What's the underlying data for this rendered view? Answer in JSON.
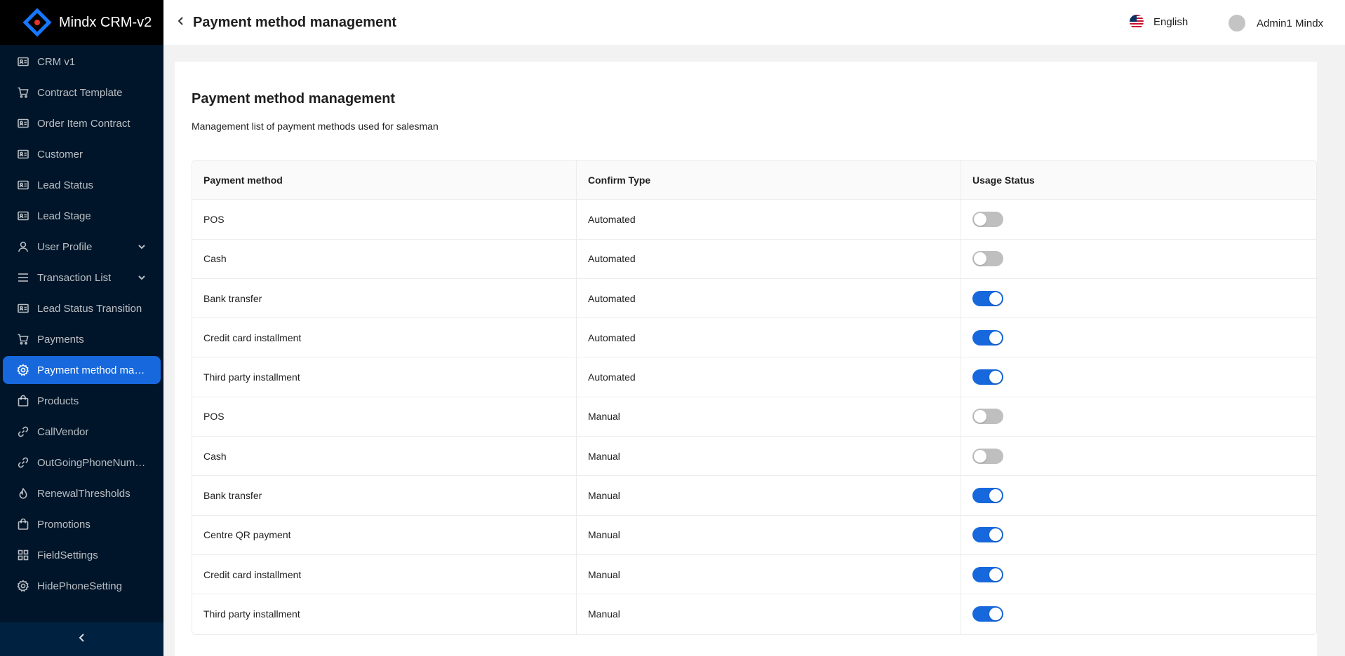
{
  "app": {
    "title": "Mindx CRM-v2"
  },
  "sidebar": {
    "items": [
      {
        "label": "CRM v1",
        "icon": "id-card-icon",
        "active": false,
        "expandable": false
      },
      {
        "label": "Contract Template",
        "icon": "cart-icon",
        "active": false,
        "expandable": false
      },
      {
        "label": "Order Item Contract",
        "icon": "id-card-icon",
        "active": false,
        "expandable": false
      },
      {
        "label": "Customer",
        "icon": "id-card-icon",
        "active": false,
        "expandable": false
      },
      {
        "label": "Lead Status",
        "icon": "id-card-icon",
        "active": false,
        "expandable": false
      },
      {
        "label": "Lead Stage",
        "icon": "id-card-icon",
        "active": false,
        "expandable": false
      },
      {
        "label": "User Profile",
        "icon": "user-icon",
        "active": false,
        "expandable": true
      },
      {
        "label": "Transaction List",
        "icon": "menu-icon",
        "active": false,
        "expandable": true
      },
      {
        "label": "Lead Status Transition",
        "icon": "id-card-icon",
        "active": false,
        "expandable": false
      },
      {
        "label": "Payments",
        "icon": "cart-icon",
        "active": false,
        "expandable": false
      },
      {
        "label": "Payment method mana...",
        "icon": "gear-icon",
        "active": true,
        "expandable": false
      },
      {
        "label": "Products",
        "icon": "bag-icon",
        "active": false,
        "expandable": false
      },
      {
        "label": "CallVendor",
        "icon": "link-icon",
        "active": false,
        "expandable": false
      },
      {
        "label": "OutGoingPhoneNumber",
        "icon": "link-icon",
        "active": false,
        "expandable": false
      },
      {
        "label": "RenewalThresholds",
        "icon": "fire-icon",
        "active": false,
        "expandable": false
      },
      {
        "label": "Promotions",
        "icon": "bag-icon",
        "active": false,
        "expandable": false
      },
      {
        "label": "FieldSettings",
        "icon": "grid-icon",
        "active": false,
        "expandable": false
      },
      {
        "label": "HidePhoneSetting",
        "icon": "gear-icon",
        "active": false,
        "expandable": false
      }
    ]
  },
  "header": {
    "title": "Payment method management",
    "language": "English",
    "user_name": "Admin1 Mindx"
  },
  "card": {
    "title": "Payment method management",
    "description": "Management list of payment methods used for salesman"
  },
  "table": {
    "headers": [
      "Payment method",
      "Confirm Type",
      "Usage Status"
    ],
    "rows": [
      {
        "method": "POS",
        "confirm": "Automated",
        "enabled": false
      },
      {
        "method": "Cash",
        "confirm": "Automated",
        "enabled": false
      },
      {
        "method": "Bank transfer",
        "confirm": "Automated",
        "enabled": true
      },
      {
        "method": "Credit card installment",
        "confirm": "Automated",
        "enabled": true
      },
      {
        "method": "Third party installment",
        "confirm": "Automated",
        "enabled": true
      },
      {
        "method": "POS",
        "confirm": "Manual",
        "enabled": false
      },
      {
        "method": "Cash",
        "confirm": "Manual",
        "enabled": false
      },
      {
        "method": "Bank transfer",
        "confirm": "Manual",
        "enabled": true
      },
      {
        "method": "Centre QR payment",
        "confirm": "Manual",
        "enabled": true
      },
      {
        "method": "Credit card installment",
        "confirm": "Manual",
        "enabled": true
      },
      {
        "method": "Third party installment",
        "confirm": "Manual",
        "enabled": true
      }
    ]
  },
  "colors": {
    "accent": "#1668dc",
    "sidebar_bg": "#001529",
    "switch_off": "#bfbfbf"
  }
}
